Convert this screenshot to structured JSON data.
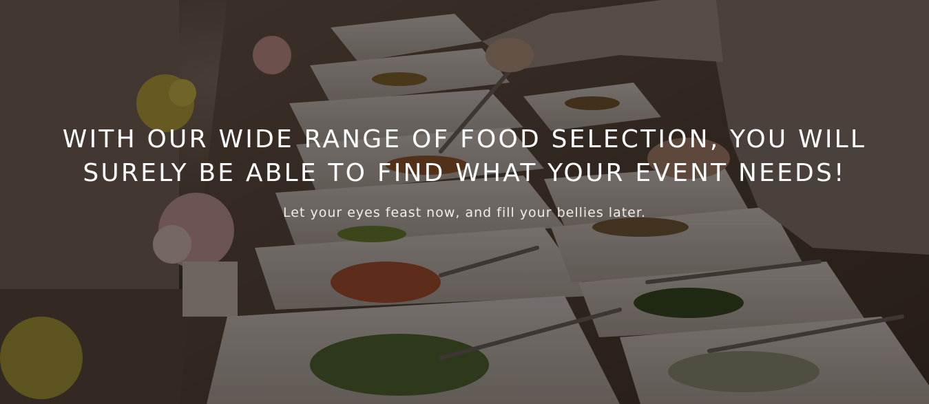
{
  "hero": {
    "headline_line1": "WITH OUR WIDE RANGE OF FOOD SELECTION, YOU WILL",
    "headline_line2": "SURELY BE ABLE TO FIND WHAT YOUR EVENT NEEDS!",
    "subheadline": "Let your eyes feast now, and fill your bellies later.",
    "background_image": "catering-buffet-photo",
    "overlay_color": "#140f0c",
    "text_color": "#ffffff"
  }
}
